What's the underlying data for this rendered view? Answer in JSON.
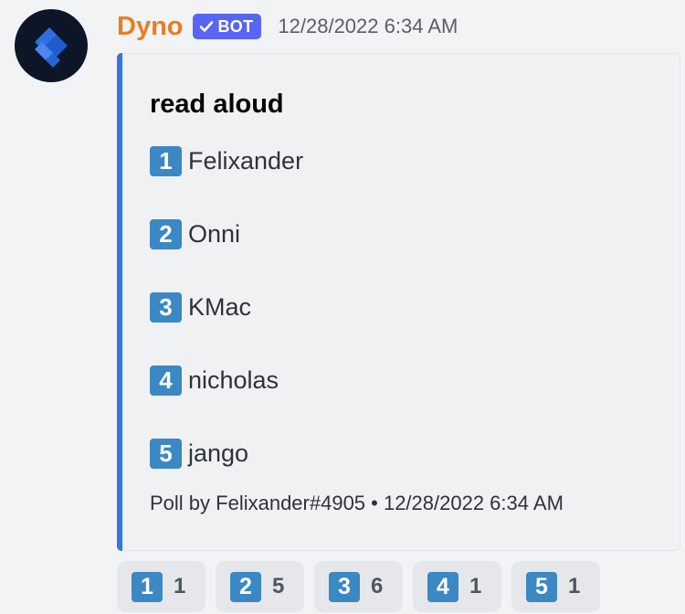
{
  "message": {
    "author": "Dyno",
    "bot_tag": "BOT",
    "timestamp": "12/28/2022 6:34 AM",
    "author_color": "#e67e22",
    "avatar_icon": "dyno-chevron-logo"
  },
  "embed": {
    "accent_color": "#3377dd",
    "title": "read aloud",
    "options": [
      {
        "number": "1",
        "name": "Felixander"
      },
      {
        "number": "2",
        "name": "Onni"
      },
      {
        "number": "3",
        "name": "KMac"
      },
      {
        "number": "4",
        "name": "nicholas"
      },
      {
        "number": "5",
        "name": "jango"
      }
    ],
    "footer": "Poll by Felixander#4905 • 12/28/2022 6:34 AM"
  },
  "reactions": [
    {
      "emoji": "1",
      "count": "1"
    },
    {
      "emoji": "2",
      "count": "5"
    },
    {
      "emoji": "3",
      "count": "6"
    },
    {
      "emoji": "4",
      "count": "1"
    },
    {
      "emoji": "5",
      "count": "1"
    }
  ]
}
